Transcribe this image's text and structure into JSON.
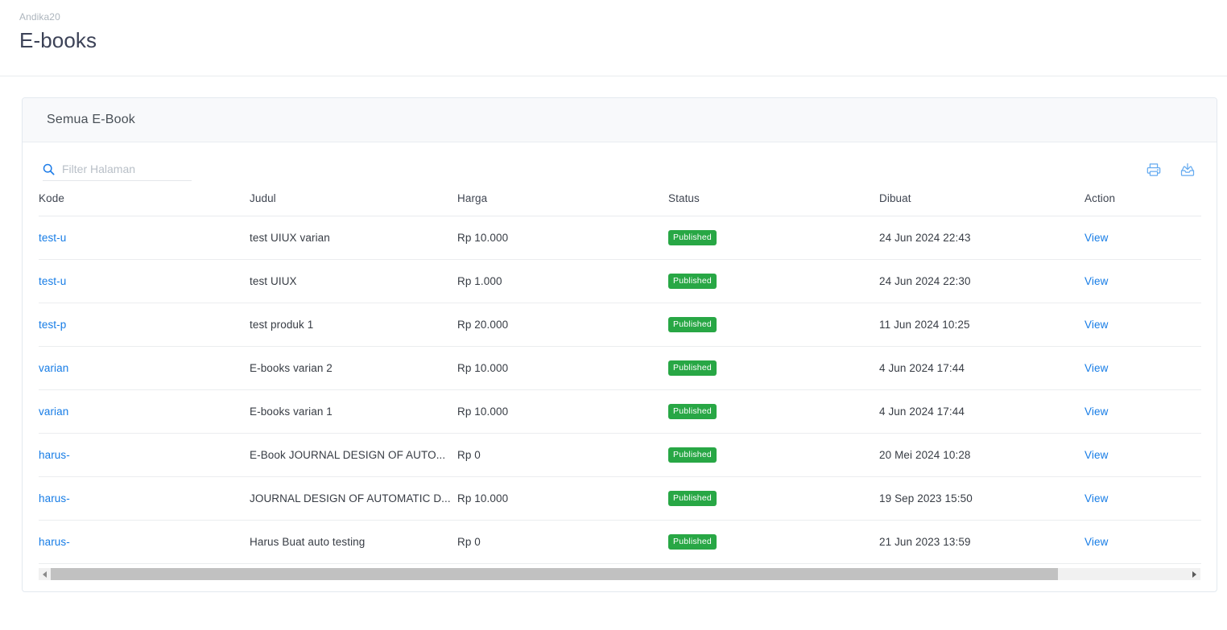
{
  "header": {
    "breadcrumb": "Andika20",
    "title": "E-books"
  },
  "card": {
    "title": "Semua E-Book"
  },
  "search": {
    "placeholder": "Filter Halaman",
    "value": "",
    "icon": "search-icon"
  },
  "toolbar": {
    "print_icon": "printer-icon",
    "export_icon": "download-tray-icon",
    "accent_color": "#5aa9f0"
  },
  "table": {
    "columns": [
      "Kode",
      "Judul",
      "Harga",
      "Status",
      "Dibuat",
      "Action"
    ],
    "rows": [
      {
        "kode": "test-u",
        "judul": "test UIUX varian",
        "harga": "Rp 10.000",
        "status": "Published",
        "dibuat": "24 Jun 2024 22:43",
        "action": "View"
      },
      {
        "kode": "test-u",
        "judul": "test UIUX",
        "harga": "Rp 1.000",
        "status": "Published",
        "dibuat": "24 Jun 2024 22:30",
        "action": "View"
      },
      {
        "kode": "test-p",
        "judul": "test produk 1",
        "harga": "Rp 20.000",
        "status": "Published",
        "dibuat": "11 Jun 2024 10:25",
        "action": "View"
      },
      {
        "kode": "varian",
        "judul": "E-books varian 2",
        "harga": "Rp 10.000",
        "status": "Published",
        "dibuat": "4 Jun 2024 17:44",
        "action": "View"
      },
      {
        "kode": "varian",
        "judul": "E-books varian 1",
        "harga": "Rp 10.000",
        "status": "Published",
        "dibuat": "4 Jun 2024 17:44",
        "action": "View"
      },
      {
        "kode": "harus-",
        "judul": "E-Book JOURNAL DESIGN OF AUTO...",
        "harga": "Rp 0",
        "status": "Published",
        "dibuat": "20 Mei 2024 10:28",
        "action": "View"
      },
      {
        "kode": "harus-",
        "judul": "JOURNAL DESIGN OF AUTOMATIC D...",
        "harga": "Rp 10.000",
        "status": "Published",
        "dibuat": "19 Sep 2023 15:50",
        "action": "View"
      },
      {
        "kode": "harus-",
        "judul": "Harus Buat auto testing",
        "harga": "Rp 0",
        "status": "Published",
        "dibuat": "21 Jun 2023 13:59",
        "action": "View"
      }
    ]
  },
  "colors": {
    "link": "#167ce6",
    "badge_published": "#28a745",
    "card_header_bg": "#f8f9fb",
    "border": "#e3e9ef"
  }
}
